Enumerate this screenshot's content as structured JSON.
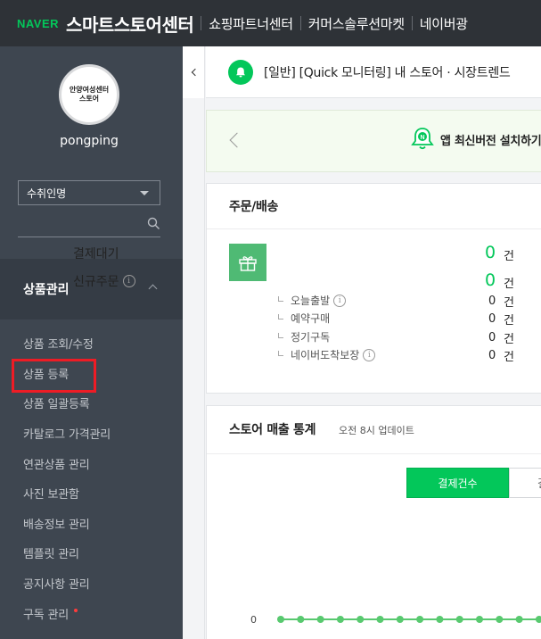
{
  "header": {
    "brand": "NAVER",
    "title": "스마트스토어센터",
    "links": [
      "쇼핑파트너센터",
      "커머스솔루션마켓",
      "네이버광"
    ]
  },
  "sidebar": {
    "avatar_lines": [
      "안양여성센터",
      "스토어"
    ],
    "username": "pongping",
    "selector_value": "수취인명",
    "section_title": "상품관리",
    "items": [
      {
        "label": "상품 조회/수정"
      },
      {
        "label": "상품 등록"
      },
      {
        "label": "상품 일괄등록"
      },
      {
        "label": "카탈로그 가격관리"
      },
      {
        "label": "연관상품 관리"
      },
      {
        "label": "사진 보관함"
      },
      {
        "label": "배송정보 관리"
      },
      {
        "label": "템플릿 관리"
      },
      {
        "label": "공지사항 관리"
      },
      {
        "label": "구독 관리"
      }
    ],
    "highlight_color": "#ee1c25"
  },
  "notice": {
    "text": "[일반] [Quick 모니터링] 내 스토어 · 시장트렌드"
  },
  "banner": {
    "text": "앱 최신버전 설치하기"
  },
  "orders": {
    "title": "주문/배송",
    "rows": [
      {
        "label": "결제대기",
        "value": "0",
        "unit": "건"
      },
      {
        "label": "신규주문",
        "value": "0",
        "unit": "건"
      },
      {
        "label": "오늘출발",
        "value": "0",
        "unit": "건"
      },
      {
        "label": "예약구매",
        "value": "0",
        "unit": "건"
      },
      {
        "label": "정기구독",
        "value": "0",
        "unit": "건"
      },
      {
        "label": "네이버도착보장",
        "value": "0",
        "unit": "건"
      }
    ]
  },
  "stats": {
    "title": "스토어 매출 통계",
    "subtitle": "오전 8시 업데이트",
    "tab_active": "결제건수",
    "tab_next": "결",
    "zero_label": "0"
  },
  "colors": {
    "accent": "#03c75a",
    "sidebar_bg": "#3e4650",
    "topbar_bg": "#2e3237"
  }
}
